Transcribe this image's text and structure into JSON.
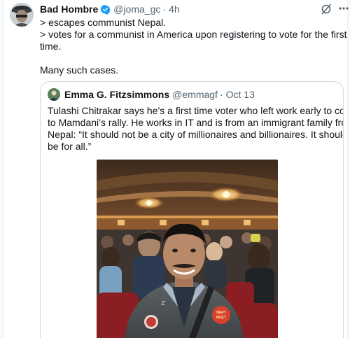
{
  "tweet": {
    "display_name": "Bad Hombre",
    "handle": "@joma_gc",
    "separator": "·",
    "time": "4h",
    "lines": [
      "> escapes communist Nepal.",
      "> votes for a communist in America upon registering to vote for the first",
      "time.",
      "Many such cases."
    ]
  },
  "quote": {
    "display_name": "Emma G. Fitzsimmons",
    "handle": "@emmagf",
    "separator": "·",
    "date": "Oct 13",
    "lines": [
      "Tulashi Chitrakar says he’s a first time voter who left work early to come",
      "to Mamdani’s rally. He works in IT and is from an immigrant family from",
      "Nepal: “It should not be a city of millionaires and billionaires. It should",
      "be for all.”"
    ],
    "photo": {
      "button_text": "Z",
      "left_tag": "MEET",
      "right_tag": "BERT"
    }
  },
  "icons": {
    "verified": "verified-badge-icon",
    "grok": "grok-slash-icon",
    "more": "more-options-icon"
  },
  "colors": {
    "verified_blue": "#1d9bf0",
    "text_primary": "#0f1419",
    "text_secondary": "#536471",
    "border": "#cfd9de"
  }
}
